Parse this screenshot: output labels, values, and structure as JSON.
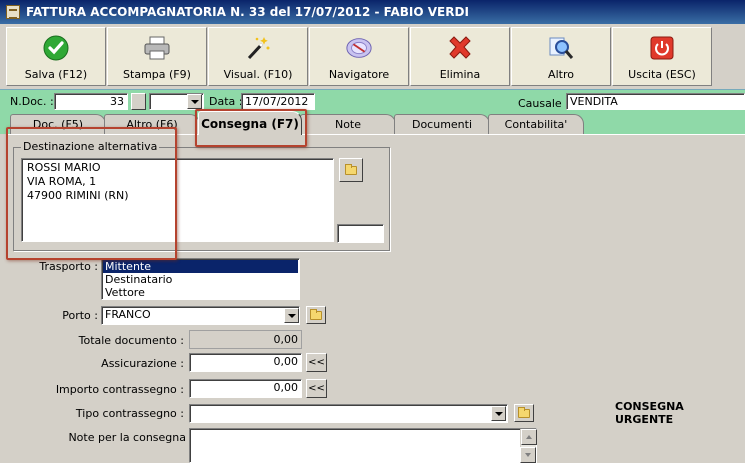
{
  "window": {
    "title": "FATTURA ACCOMPAGNATORIA N. 33  del 17/07/2012 - FABIO VERDI"
  },
  "toolbar": [
    {
      "label": "Salva (F12)",
      "icon": "check-icon"
    },
    {
      "label": "Stampa (F9)",
      "icon": "printer-icon"
    },
    {
      "label": "Visual. (F10)",
      "icon": "magic-wand-icon"
    },
    {
      "label": "Navigatore",
      "icon": "compass-icon"
    },
    {
      "label": "Elimina",
      "icon": "delete-icon"
    },
    {
      "label": "Altro",
      "icon": "magnifier-icon"
    },
    {
      "label": "Uscita (ESC)",
      "icon": "power-icon"
    }
  ],
  "header": {
    "ndoc_label": "N.Doc. :",
    "ndoc_value": "33",
    "data_label": "Data :",
    "data_value": "17/07/2012",
    "causale_label": "Causale :",
    "causale_value": "VENDITA"
  },
  "tabs": [
    {
      "label": "Doc. (F5)"
    },
    {
      "label": "Altro (F6)"
    },
    {
      "label": "Consegna (F7)",
      "active": true
    },
    {
      "label": "Note"
    },
    {
      "label": "Documenti"
    },
    {
      "label": "Contabilita'"
    }
  ],
  "destinazione": {
    "legend": "Destinazione alternativa",
    "lines": [
      "ROSSI MARIO",
      "VIA ROMA, 1",
      "47900 RIMINI (RN)"
    ]
  },
  "form": {
    "trasporto_label": "Trasporto :",
    "trasporto_options": [
      "Mittente",
      "Destinatario",
      "Vettore"
    ],
    "trasporto_selected": "Mittente",
    "porto_label": "Porto :",
    "porto_value": "FRANCO",
    "totale_label": "Totale documento :",
    "totale_value": "0,00",
    "assicurazione_label": "Assicurazione :",
    "assicurazione_value": "0,00",
    "contrassegno_label": "Importo contrassegno :",
    "contrassegno_value": "0,00",
    "tipo_label": "Tipo contrassegno :",
    "tipo_value": "",
    "note_label": "Note per la consegna",
    "chevron_label": "<<",
    "urgente_label": "CONSEGNA URGENTE"
  },
  "colors": {
    "title": "#0a246a",
    "bar": "#8fd9a8",
    "highlight": "#b5432f"
  }
}
